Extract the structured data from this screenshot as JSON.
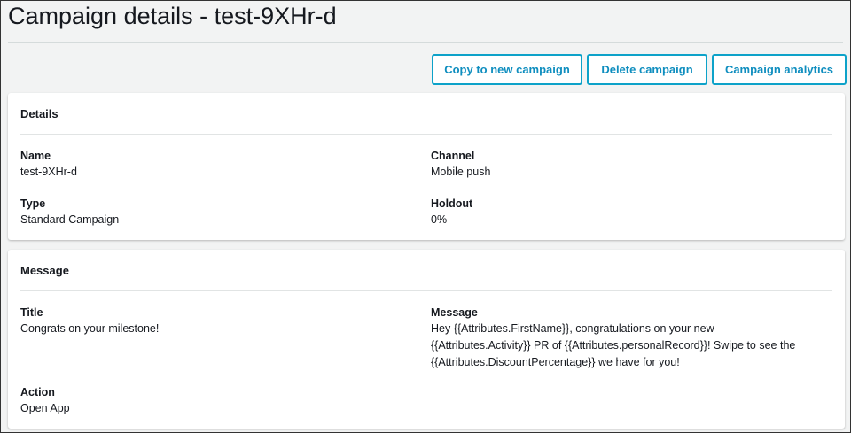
{
  "header": {
    "title": "Campaign details - test-9XHr-d"
  },
  "toolbar": {
    "copy": "Copy to new campaign",
    "delete": "Delete campaign",
    "analytics": "Campaign analytics"
  },
  "details": {
    "heading": "Details",
    "name_label": "Name",
    "name": "test-9XHr-d",
    "channel_label": "Channel",
    "channel": "Mobile push",
    "type_label": "Type",
    "type": "Standard Campaign",
    "holdout_label": "Holdout",
    "holdout": "0%"
  },
  "message": {
    "heading": "Message",
    "title_label": "Title",
    "title": "Congrats on your milestone!",
    "message_label": "Message",
    "message_lines": [
      "Hey {{Attributes.FirstName}}, congratulations on your new",
      "{{Attributes.Activity}} PR of {{Attributes.personalRecord}}! Swipe to see the",
      "{{Attributes.DiscountPercentage}} we have for you!"
    ],
    "action_label": "Action",
    "action": "Open App"
  }
}
